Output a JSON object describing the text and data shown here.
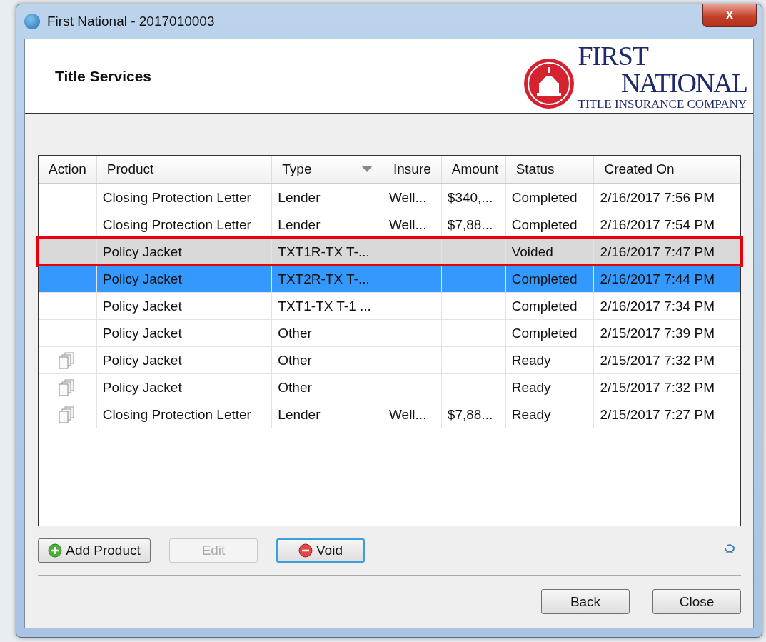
{
  "window": {
    "title": "First National - 2017010003",
    "close_button": "X"
  },
  "header": {
    "title": "Title Services",
    "logo": {
      "line1": "FIRST",
      "line2": "NATIONAL",
      "line3": "TITLE INSURANCE COMPANY"
    }
  },
  "table": {
    "columns": [
      {
        "label": "Action",
        "sortable": false
      },
      {
        "label": "Product",
        "sortable": false
      },
      {
        "label": "Type",
        "sortable": true
      },
      {
        "label": "Insure",
        "sortable": false
      },
      {
        "label": "Amount",
        "sortable": false
      },
      {
        "label": "Status",
        "sortable": false
      },
      {
        "label": "Created On",
        "sortable": false
      }
    ],
    "rows": [
      {
        "action_icon": false,
        "product": "Closing Protection Letter",
        "type": "Lender",
        "insured": "Well...",
        "amount": "$340,...",
        "status": "Completed",
        "created_on": "2/16/2017 7:56 PM",
        "selected": false,
        "outlined": false
      },
      {
        "action_icon": false,
        "product": "Closing Protection Letter",
        "type": "Lender",
        "insured": "Well...",
        "amount": "$7,88...",
        "status": "Completed",
        "created_on": "2/16/2017 7:54 PM",
        "selected": false,
        "outlined": false
      },
      {
        "action_icon": false,
        "product": "Policy Jacket",
        "type": "TXT1R-TX T-...",
        "insured": "",
        "amount": "",
        "status": "Voided",
        "created_on": "2/16/2017 7:47 PM",
        "selected": false,
        "outlined": true
      },
      {
        "action_icon": false,
        "product": "Policy Jacket",
        "type": "TXT2R-TX T-...",
        "insured": "",
        "amount": "",
        "status": "Completed",
        "created_on": "2/16/2017 7:44 PM",
        "selected": true,
        "outlined": false
      },
      {
        "action_icon": false,
        "product": "Policy Jacket",
        "type": "TXT1-TX T-1 ...",
        "insured": "",
        "amount": "",
        "status": "Completed",
        "created_on": "2/16/2017 7:34 PM",
        "selected": false,
        "outlined": false
      },
      {
        "action_icon": false,
        "product": "Policy Jacket",
        "type": "Other",
        "insured": "",
        "amount": "",
        "status": "Completed",
        "created_on": "2/15/2017 7:39 PM",
        "selected": false,
        "outlined": false
      },
      {
        "action_icon": true,
        "product": "Policy Jacket",
        "type": "Other",
        "insured": "",
        "amount": "",
        "status": "Ready",
        "created_on": "2/15/2017 7:32 PM",
        "selected": false,
        "outlined": false
      },
      {
        "action_icon": true,
        "product": "Policy Jacket",
        "type": "Other",
        "insured": "",
        "amount": "",
        "status": "Ready",
        "created_on": "2/15/2017 7:32 PM",
        "selected": false,
        "outlined": false
      },
      {
        "action_icon": true,
        "product": "Closing Protection Letter",
        "type": "Lender",
        "insured": "Well...",
        "amount": "$7,88...",
        "status": "Ready",
        "created_on": "2/15/2017 7:27 PM",
        "selected": false,
        "outlined": false
      }
    ]
  },
  "actions": [
    {
      "label": "Add Product",
      "kind": "add",
      "disabled": false,
      "focused": false
    },
    {
      "label": "Edit",
      "kind": "plain",
      "disabled": true,
      "focused": false
    },
    {
      "label": "Void",
      "kind": "remove",
      "disabled": false,
      "focused": true
    }
  ],
  "footer_buttons": [
    {
      "label": "Back"
    },
    {
      "label": "Close"
    }
  ]
}
